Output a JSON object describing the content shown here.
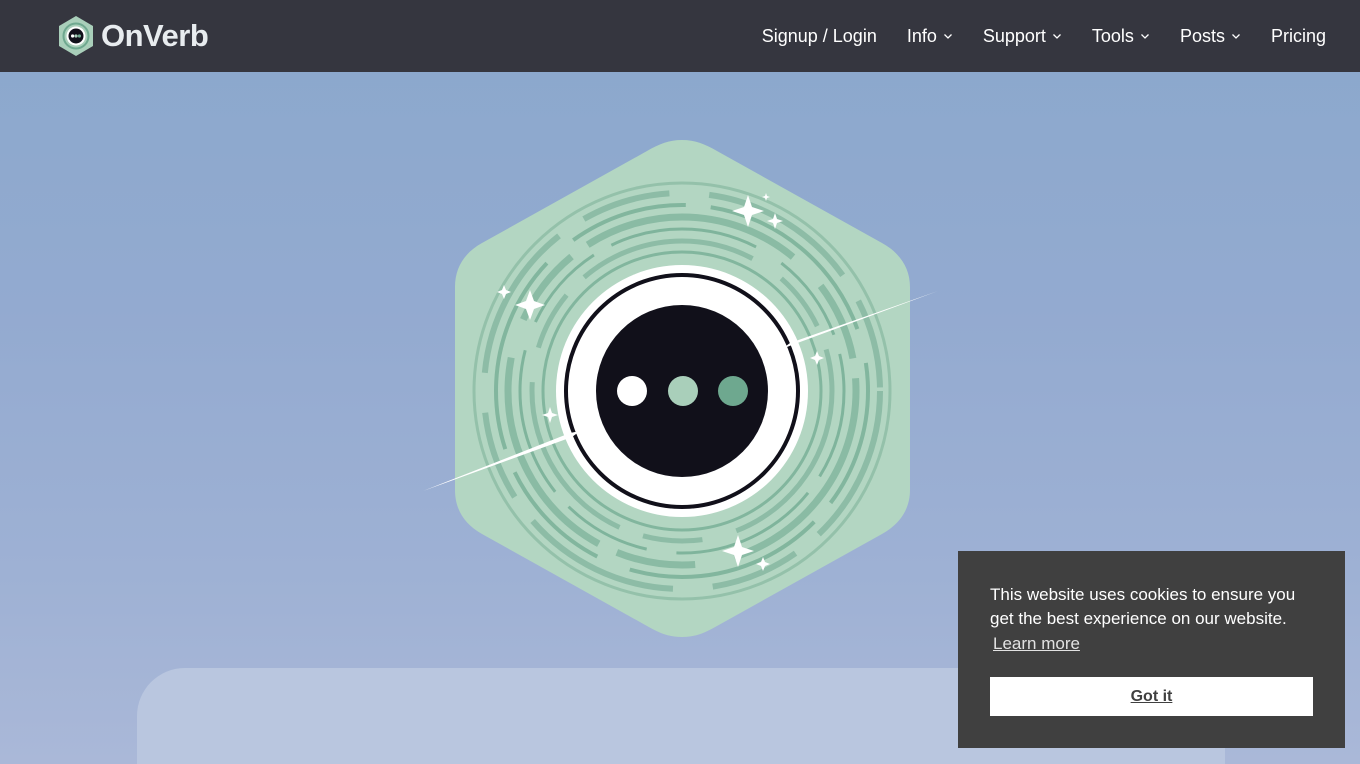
{
  "header": {
    "brand": "OnVerb",
    "nav": [
      {
        "label": "Signup / Login",
        "dropdown": false
      },
      {
        "label": "Info",
        "dropdown": true
      },
      {
        "label": "Support",
        "dropdown": true
      },
      {
        "label": "Tools",
        "dropdown": true
      },
      {
        "label": "Posts",
        "dropdown": true
      },
      {
        "label": "Pricing",
        "dropdown": false
      }
    ]
  },
  "hero": {
    "logo_icon": "onverb-hexagon-logo-icon"
  },
  "cookie_banner": {
    "message": "This website uses cookies to ensure you get the best experience on our website.",
    "learn_more": "Learn more",
    "accept": "Got it"
  },
  "colors": {
    "navbar": "#35363f",
    "hexagon": "#b3d6c2",
    "swirl": "#6ea88f",
    "core": "#11101a",
    "cookie_bg": "#404040"
  }
}
